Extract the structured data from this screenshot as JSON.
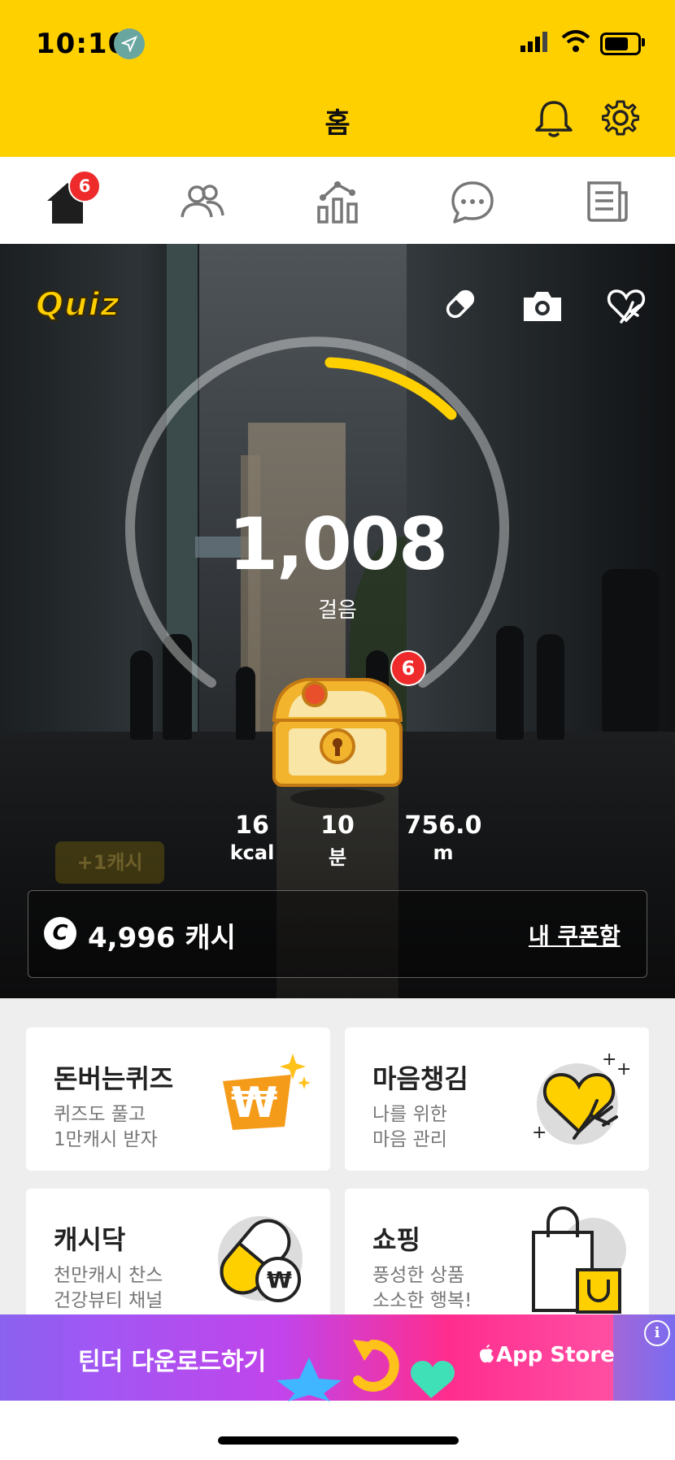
{
  "status_bar": {
    "time": "10:10"
  },
  "header": {
    "title": "홈",
    "bell_icon": "bell-icon",
    "settings_icon": "gear-icon",
    "background": "#FFD000"
  },
  "tabs": [
    {
      "name": "home",
      "icon": "home-icon",
      "badge": "6",
      "active": true
    },
    {
      "name": "friends",
      "icon": "friends-icon"
    },
    {
      "name": "stats",
      "icon": "chart-icon"
    },
    {
      "name": "chat",
      "icon": "chat-icon"
    },
    {
      "name": "news",
      "icon": "news-icon"
    }
  ],
  "hero": {
    "quiz_label": "Quiz",
    "icons": [
      "pill-icon",
      "camera-icon",
      "heart-hand-icon"
    ],
    "step_count": "1,008",
    "step_label": "걸음",
    "chest_badge": "6",
    "stats": [
      {
        "value": "16",
        "unit": "kcal"
      },
      {
        "value": "10",
        "unit": "분"
      },
      {
        "value": "756.0",
        "unit": "m"
      }
    ],
    "bonus_label": "+1캐시",
    "cash_icon": "C",
    "cash_amount": "4,996 캐시",
    "coupon_link": "내 쿠폰함"
  },
  "cards": [
    {
      "title": "돈버는퀴즈",
      "sub1": "퀴즈도 풀고",
      "sub2": "1만캐시 받자",
      "icon": "won-sparkle-icon"
    },
    {
      "title": "마음챙김",
      "sub1": "나를 위한",
      "sub2": "마음 관리",
      "icon": "heart-hand-icon"
    },
    {
      "title": "캐시닥",
      "sub1": "천만캐시 찬스",
      "sub2": "건강뷰티 채널",
      "icon": "pill-coin-icon"
    },
    {
      "title": "쇼핑",
      "sub1": "풍성한 상품",
      "sub2": "소소한 행복!",
      "icon": "shopping-bag-icon"
    }
  ],
  "ad": {
    "text": "틴더 다운로드하기",
    "store": "App Store",
    "info": "i"
  },
  "accent": "#FFD000",
  "badge_color": "#EE2A2A"
}
